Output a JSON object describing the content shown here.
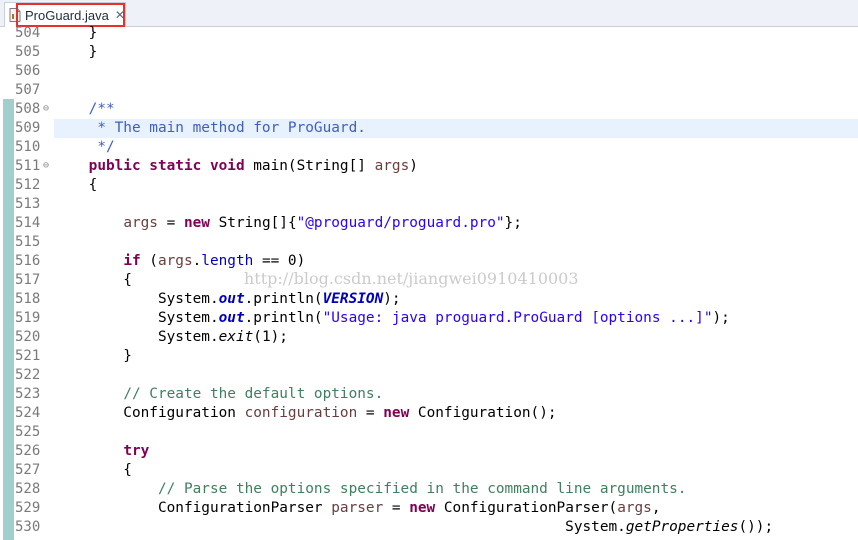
{
  "tab": {
    "title": "ProGuard.java",
    "close_glyph": "✕",
    "icon": "java-file-icon",
    "highlight_color": "#e8302a"
  },
  "colors": {
    "keyword": "#7f0055",
    "javadoc": "#3f5fbf",
    "comment": "#3f7f5f",
    "string": "#2a00ff",
    "local_variable": "#6a3e3e",
    "field": "#0000c0",
    "current_line": "#e8f2fe",
    "change_ruler": "#9fd0ce"
  },
  "watermark": "http://blog.csdn.net/jiangwei0910410003",
  "lines": [
    {
      "n": "504",
      "tokens": [
        {
          "t": "    }"
        }
      ]
    },
    {
      "n": "505",
      "tokens": [
        {
          "t": "    }"
        }
      ]
    },
    {
      "n": "506",
      "tokens": []
    },
    {
      "n": "507",
      "tokens": []
    },
    {
      "n": "508",
      "fold": "⊖",
      "tokens": [
        {
          "t": "    "
        },
        {
          "t": "/**",
          "c": "jd"
        }
      ]
    },
    {
      "n": "509",
      "current": true,
      "tokens": [
        {
          "t": "     * The main method for ProGuard.",
          "c": "jd"
        }
      ]
    },
    {
      "n": "510",
      "tokens": [
        {
          "t": "     */",
          "c": "jd"
        }
      ]
    },
    {
      "n": "511",
      "fold": "⊖",
      "tokens": [
        {
          "t": "    "
        },
        {
          "t": "public static void",
          "c": "kw"
        },
        {
          "t": " main(String[] "
        },
        {
          "t": "args",
          "c": "var"
        },
        {
          "t": ")"
        }
      ]
    },
    {
      "n": "512",
      "tokens": [
        {
          "t": "    {"
        }
      ]
    },
    {
      "n": "513",
      "tokens": []
    },
    {
      "n": "514",
      "tokens": [
        {
          "t": "        "
        },
        {
          "t": "args",
          "c": "var"
        },
        {
          "t": " = "
        },
        {
          "t": "new",
          "c": "kw"
        },
        {
          "t": " String[]{"
        },
        {
          "t": "\"@proguard/proguard.pro\"",
          "c": "str"
        },
        {
          "t": "};"
        }
      ]
    },
    {
      "n": "515",
      "tokens": []
    },
    {
      "n": "516",
      "tokens": [
        {
          "t": "        "
        },
        {
          "t": "if",
          "c": "kw"
        },
        {
          "t": " ("
        },
        {
          "t": "args",
          "c": "var"
        },
        {
          "t": "."
        },
        {
          "t": "length",
          "c": "fld"
        },
        {
          "t": " == 0)"
        }
      ]
    },
    {
      "n": "517",
      "tokens": [
        {
          "t": "        {"
        }
      ]
    },
    {
      "n": "518",
      "tokens": [
        {
          "t": "            System."
        },
        {
          "t": "out",
          "c": "sf"
        },
        {
          "t": ".println("
        },
        {
          "t": "VERSION",
          "c": "sf"
        },
        {
          "t": ");"
        }
      ]
    },
    {
      "n": "519",
      "tokens": [
        {
          "t": "            System."
        },
        {
          "t": "out",
          "c": "sf"
        },
        {
          "t": ".println("
        },
        {
          "t": "\"Usage: java proguard.ProGuard [options ...]\"",
          "c": "str"
        },
        {
          "t": ");"
        }
      ]
    },
    {
      "n": "520",
      "tokens": [
        {
          "t": "            System."
        },
        {
          "t": "exit",
          "c": "it"
        },
        {
          "t": "(1);"
        }
      ]
    },
    {
      "n": "521",
      "tokens": [
        {
          "t": "        }"
        }
      ]
    },
    {
      "n": "522",
      "tokens": []
    },
    {
      "n": "523",
      "tokens": [
        {
          "t": "        "
        },
        {
          "t": "// Create the default options.",
          "c": "cm"
        }
      ]
    },
    {
      "n": "524",
      "tokens": [
        {
          "t": "        Configuration "
        },
        {
          "t": "configuration",
          "c": "var"
        },
        {
          "t": " = "
        },
        {
          "t": "new",
          "c": "kw"
        },
        {
          "t": " Configuration();"
        }
      ]
    },
    {
      "n": "525",
      "tokens": []
    },
    {
      "n": "526",
      "tokens": [
        {
          "t": "        "
        },
        {
          "t": "try",
          "c": "kw"
        }
      ]
    },
    {
      "n": "527",
      "tokens": [
        {
          "t": "        {"
        }
      ]
    },
    {
      "n": "528",
      "tokens": [
        {
          "t": "            "
        },
        {
          "t": "// Parse the options specified in the command line arguments.",
          "c": "cm"
        }
      ]
    },
    {
      "n": "529",
      "tokens": [
        {
          "t": "            ConfigurationParser "
        },
        {
          "t": "parser",
          "c": "var"
        },
        {
          "t": " = "
        },
        {
          "t": "new",
          "c": "kw"
        },
        {
          "t": " ConfigurationParser("
        },
        {
          "t": "args",
          "c": "var"
        },
        {
          "t": ","
        }
      ]
    },
    {
      "n": "530",
      "tokens": [
        {
          "t": "                                                           System."
        },
        {
          "t": "getProperties",
          "c": "it"
        },
        {
          "t": "());"
        }
      ]
    }
  ]
}
